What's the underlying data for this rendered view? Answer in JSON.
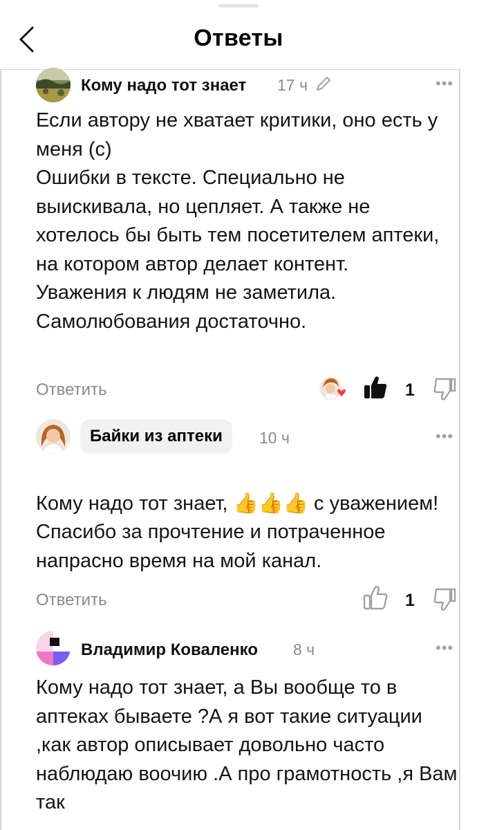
{
  "header": {
    "title": "Ответы"
  },
  "comments": [
    {
      "author": "Кому надо тот знает",
      "time": "17 ч",
      "menu": "•••",
      "text": "Если автору не хватает критики, оно есть у меня (с)\nОшибки в тексте. Специально не выискивала, но цепляет. А также не хотелось бы быть тем посетителем аптеки, на котором автор делает контент.\nУважения к людям не заметила. Самолюбования достаточно.",
      "reply": "Ответить",
      "likes": "1",
      "liked": true
    },
    {
      "author": "Байки из аптеки",
      "time": "10 ч",
      "menu": "•••",
      "text_before": "Кому надо тот знает, ",
      "emoji": "👍👍👍",
      "text_after": " с уважением! Спасибо за прочтение и потраченное напрасно время на мой канал.",
      "reply": "Ответить",
      "likes": "1",
      "liked": false
    },
    {
      "author": "Владимир Коваленко",
      "time": "8 ч",
      "menu": "•••",
      "text": "Кому надо тот знает, а Вы вообще то в аптеках бываете ?А я вот такие ситуации ,как автор описывает довольно часто наблюдаю воочию .А про грамотность ,я Вам так"
    }
  ],
  "colors": {
    "muted": "#8a8a8e",
    "heart": "#f0443b",
    "chip_bg": "#f1f1f3",
    "thumb_emoji": "#f5b700"
  }
}
